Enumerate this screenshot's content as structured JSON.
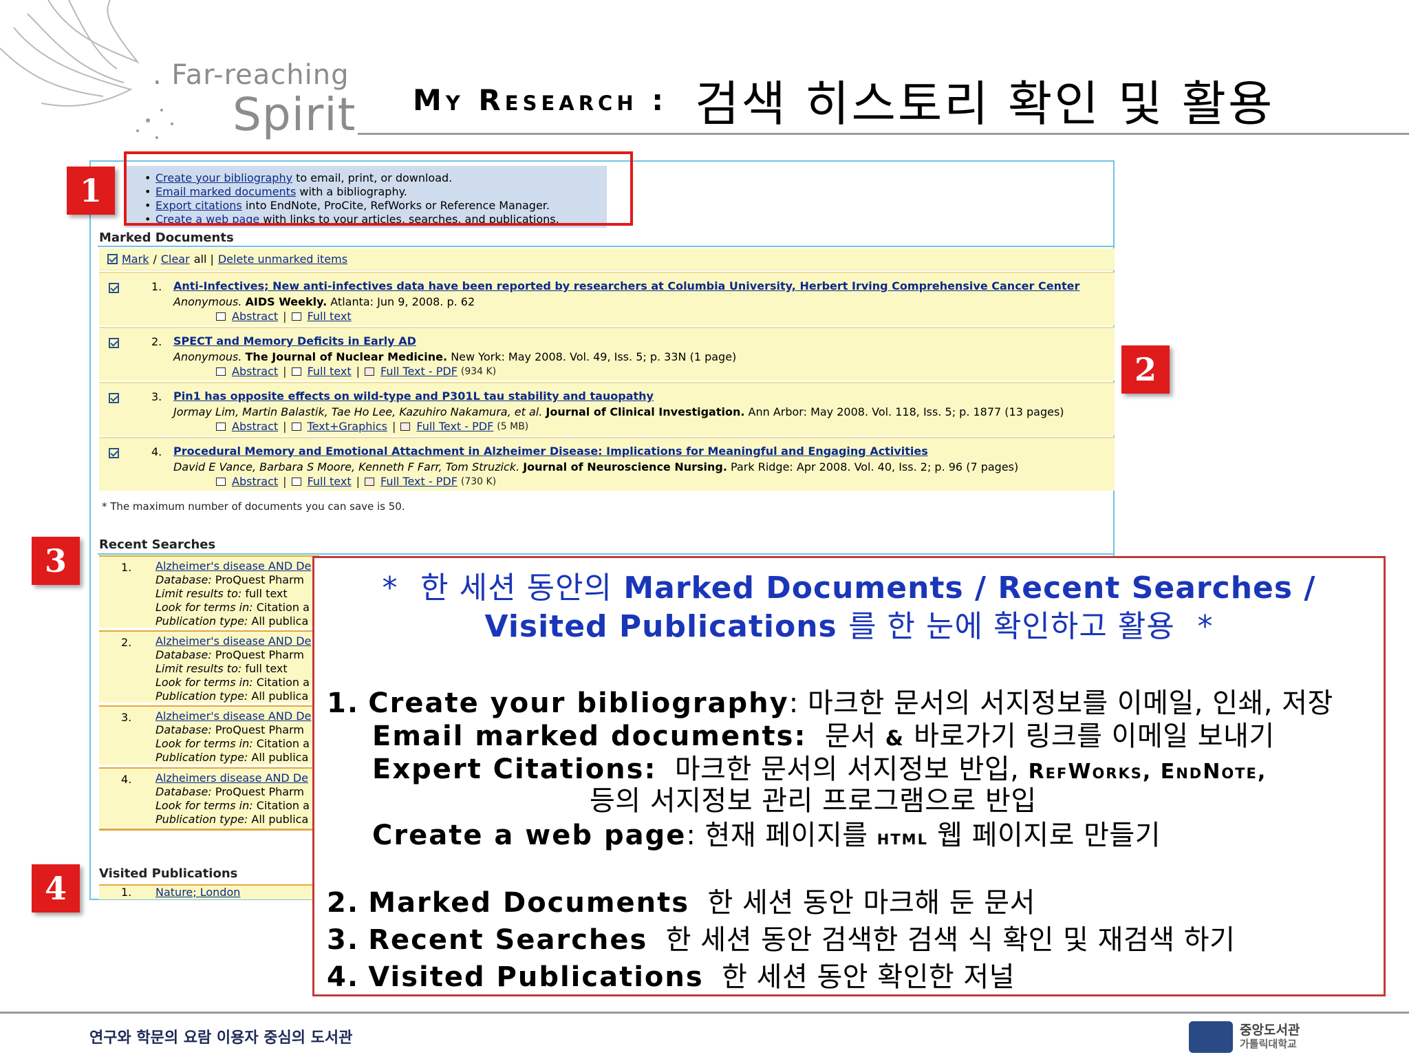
{
  "logo": {
    "line1": ". Far-reaching",
    "line2": "Spirit"
  },
  "title": {
    "en": "My Research :",
    "ko": "검색 히스토리 확인 및 활용"
  },
  "links_box": {
    "items": [
      {
        "link": "Create your bibliography",
        "text": " to email, print, or download."
      },
      {
        "link": "Email marked documents",
        "text": " with a bibliography."
      },
      {
        "link": "Export citations",
        "text": " into EndNote, ProCite, RefWorks or Reference Manager."
      },
      {
        "link": "Create a web page",
        "text": " with links to your articles, searches, and publications."
      }
    ]
  },
  "marked_documents": {
    "heading": "Marked Documents",
    "toolbar": {
      "mark": "Mark",
      "slash": "/",
      "clear": "Clear",
      "all": "all |",
      "delete": "Delete unmarked items"
    },
    "rows": [
      {
        "num": "1.",
        "title": "Anti-Infectives; New anti-infectives data have been reported by researchers at Columbia University, Herbert Irving Comprehensive Cancer Center",
        "authors": "Anonymous.",
        "pub": "AIDS Weekly.",
        "rest": "Atlanta: Jun 9, 2008. p. 62",
        "links": [
          "Abstract",
          "Full text"
        ],
        "size": ""
      },
      {
        "num": "2.",
        "title": "SPECT and Memory Deficits in Early AD",
        "authors": "Anonymous.",
        "pub": "The Journal of Nuclear Medicine.",
        "rest": "New York: May 2008. Vol. 49, Iss. 5; p. 33N (1 page)",
        "links": [
          "Abstract",
          "Full text",
          "Full Text - PDF"
        ],
        "size": "(934 K)"
      },
      {
        "num": "3.",
        "title": "Pin1 has opposite effects on wild-type and P301L tau stability and tauopathy",
        "authors": "Jormay Lim, Martin Balastik, Tae Ho Lee, Kazuhiro Nakamura, et al.",
        "pub": "Journal of Clinical Investigation.",
        "rest": "Ann Arbor: May 2008. Vol. 118, Iss. 5; p. 1877 (13 pages)",
        "links": [
          "Abstract",
          "Text+Graphics",
          "Full Text - PDF"
        ],
        "size": "(5 MB)"
      },
      {
        "num": "4.",
        "title": "Procedural Memory and Emotional Attachment in Alzheimer Disease: Implications for Meaningful and Engaging Activities",
        "authors": "David E Vance, Barbara S Moore, Kenneth F Farr, Tom Struzick.",
        "pub": "Journal of Neuroscience Nursing.",
        "rest": "Park Ridge: Apr 2008. Vol. 40, Iss. 2; p. 96 (7 pages)",
        "links": [
          "Abstract",
          "Full text",
          "Full Text - PDF"
        ],
        "size": "(730 K)"
      }
    ],
    "note": "* The maximum number of documents you can save is 50."
  },
  "recent_searches": {
    "heading": "Recent Searches",
    "items": [
      {
        "num": "1.",
        "query": "Alzheimer's disease AND De",
        "lines": [
          [
            "Database:",
            " ProQuest Pharm"
          ],
          [
            "Limit results to:",
            " full text"
          ],
          [
            "Look for terms in:",
            " Citation a"
          ],
          [
            "Publication type:",
            " All publica"
          ]
        ]
      },
      {
        "num": "2.",
        "query": "Alzheimer's disease AND De",
        "lines": [
          [
            "Database:",
            " ProQuest Pharm"
          ],
          [
            "Limit results to:",
            " full text"
          ],
          [
            "Look for terms in:",
            " Citation a"
          ],
          [
            "Publication type:",
            " All publica"
          ]
        ]
      },
      {
        "num": "3.",
        "query": "Alzheimer's disease AND De",
        "lines": [
          [
            "Database:",
            " ProQuest Pharm"
          ],
          [
            "Look for terms in:",
            " Citation a"
          ],
          [
            "Publication type:",
            " All publica"
          ]
        ]
      },
      {
        "num": "4.",
        "query": "Alzheimers disease AND De",
        "lines": [
          [
            "Database:",
            " ProQuest Pharm"
          ],
          [
            "Look for terms in:",
            " Citation a"
          ],
          [
            "Publication type:",
            " All publica"
          ]
        ]
      }
    ]
  },
  "visited_publications": {
    "heading": "Visited Publications",
    "items": [
      {
        "num": "1.",
        "link": "Nature; London"
      }
    ]
  },
  "tags": [
    "1",
    "2",
    "3",
    "4"
  ],
  "callout": {
    "head1_bullet": "*",
    "head1_ko": "한 세션 동안의",
    "head1_en": "Marked Documents / Recent Searches /",
    "head2_en": "Visited Publications",
    "head2_ko": "를 한 눈에 확인하고 활용",
    "head2_bullet": "*",
    "l1_num": "1.",
    "l1_term": "Create your bibliography",
    "l1_colon": ":",
    "l1_desc": "마크한 문서의 서지정보를 이메일, 인쇄, 저장",
    "l2_term": "Email marked documents",
    "l2_colon": ":",
    "l2_desc_a": "문서",
    "l2_amp": "&",
    "l2_desc_b": "바로가기 링크를 이메일 보내기",
    "l3_term": "Expert Citations",
    "l3_colon": ":",
    "l3_desc": "마크한 문서의 서지정보 반입,",
    "l3_sc": "RefWorks, EndNote,",
    "l4_desc": "등의 서지정보 관리 프로그램으로 반입",
    "l5_term": "Create a web page",
    "l5_colon": ":",
    "l5_desc_a": "현재 페이지를",
    "l5_sc": "html",
    "l5_desc_b": "웹 페이지로 만들기",
    "i2_num": "2.",
    "i2_term": "Marked Documents",
    "i2_desc": "한 세션 동안 마크해 둔 문서",
    "i3_num": "3.",
    "i3_term": "Recent Searches",
    "i3_desc": "한 세션 동안 검색한 검색 식 확인 및 재검색 하기",
    "i4_num": "4.",
    "i4_term": "Visited Publications",
    "i4_desc": "한 세션 동안 확인한 저널"
  },
  "footer": {
    "slogan": "연구와 학문의 요람 이용자 중심의 도서관",
    "logo_line1": "중앙도서관",
    "logo_line2": "가톨릭대학교"
  }
}
